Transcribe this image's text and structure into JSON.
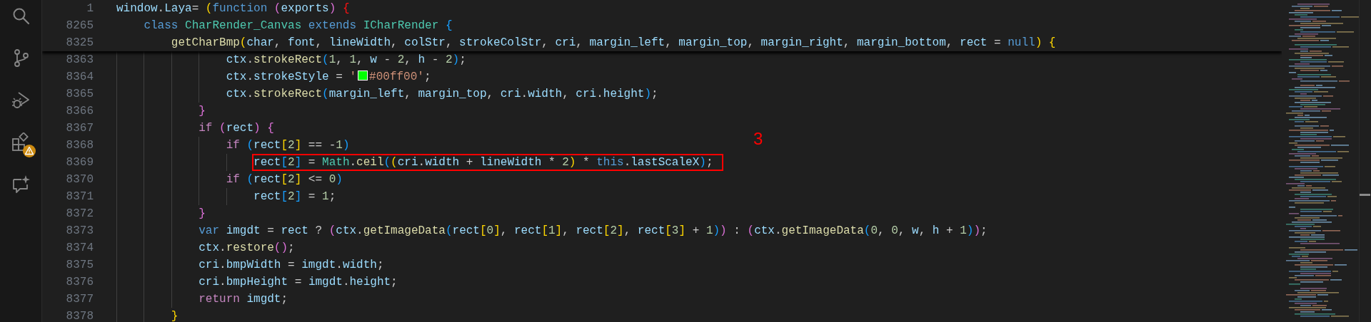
{
  "activity_bar": {
    "items": [
      {
        "kind": "search",
        "warning": false
      },
      {
        "kind": "source-control",
        "warning": false
      },
      {
        "kind": "run-debug",
        "warning": false
      },
      {
        "kind": "extensions",
        "warning": true
      },
      {
        "kind": "chat",
        "warning": false
      }
    ]
  },
  "editor": {
    "sticky_lines": [
      {
        "number": "1",
        "tokens": [
          {
            "kind": "var",
            "text": "window"
          },
          {
            "kind": "plain",
            "text": "."
          },
          {
            "kind": "var",
            "text": "Laya"
          },
          {
            "kind": "plain",
            "text": "= "
          },
          {
            "kind": "b1",
            "text": "("
          },
          {
            "kind": "kw",
            "text": "function"
          },
          {
            "kind": "b2",
            "text": " ("
          },
          {
            "kind": "var",
            "text": "exports"
          },
          {
            "kind": "b2",
            "text": ")"
          },
          {
            "kind": "bad",
            "text": " {"
          }
        ]
      },
      {
        "number": "8265",
        "tokens": [
          {
            "kind": "kw",
            "text": "    class"
          },
          {
            "kind": "cls",
            "text": " CharRender_Canvas"
          },
          {
            "kind": "kw",
            "text": " extends"
          },
          {
            "kind": "cls",
            "text": " ICharRender"
          },
          {
            "kind": "b3",
            "text": " {"
          }
        ]
      },
      {
        "number": "8325",
        "tokens": [
          {
            "kind": "fn",
            "text": "        getCharBmp"
          },
          {
            "kind": "b1",
            "text": "("
          },
          {
            "kind": "var",
            "text": "char"
          },
          {
            "kind": "plain",
            "text": ", "
          },
          {
            "kind": "var",
            "text": "font"
          },
          {
            "kind": "plain",
            "text": ", "
          },
          {
            "kind": "var",
            "text": "lineWidth"
          },
          {
            "kind": "plain",
            "text": ", "
          },
          {
            "kind": "var",
            "text": "colStr"
          },
          {
            "kind": "plain",
            "text": ", "
          },
          {
            "kind": "var",
            "text": "strokeColStr"
          },
          {
            "kind": "plain",
            "text": ", "
          },
          {
            "kind": "var",
            "text": "cri"
          },
          {
            "kind": "plain",
            "text": ", "
          },
          {
            "kind": "var",
            "text": "margin_left"
          },
          {
            "kind": "plain",
            "text": ", "
          },
          {
            "kind": "var",
            "text": "margin_top"
          },
          {
            "kind": "plain",
            "text": ", "
          },
          {
            "kind": "var",
            "text": "margin_right"
          },
          {
            "kind": "plain",
            "text": ", "
          },
          {
            "kind": "var",
            "text": "margin_bottom"
          },
          {
            "kind": "plain",
            "text": ", "
          },
          {
            "kind": "var",
            "text": "rect"
          },
          {
            "kind": "plain",
            "text": " = "
          },
          {
            "kind": "kw",
            "text": "null"
          },
          {
            "kind": "b1",
            "text": ")"
          },
          {
            "kind": "b1",
            "text": " {"
          }
        ]
      }
    ],
    "lines": [
      {
        "number": "8363",
        "boxed": false,
        "tokens": [
          {
            "kind": "var",
            "text": "                ctx"
          },
          {
            "kind": "plain",
            "text": "."
          },
          {
            "kind": "fn",
            "text": "strokeRect"
          },
          {
            "kind": "b3",
            "text": "("
          },
          {
            "kind": "num",
            "text": "1"
          },
          {
            "kind": "plain",
            "text": ", "
          },
          {
            "kind": "num",
            "text": "1"
          },
          {
            "kind": "plain",
            "text": ", "
          },
          {
            "kind": "var",
            "text": "w"
          },
          {
            "kind": "plain",
            "text": " - "
          },
          {
            "kind": "num",
            "text": "2"
          },
          {
            "kind": "plain",
            "text": ", "
          },
          {
            "kind": "var",
            "text": "h"
          },
          {
            "kind": "plain",
            "text": " - "
          },
          {
            "kind": "num",
            "text": "2"
          },
          {
            "kind": "b3",
            "text": ")"
          },
          {
            "kind": "plain",
            "text": ";"
          }
        ]
      },
      {
        "number": "8364",
        "boxed": false,
        "tokens": [
          {
            "kind": "var",
            "text": "                ctx"
          },
          {
            "kind": "plain",
            "text": "."
          },
          {
            "kind": "var",
            "text": "strokeStyle"
          },
          {
            "kind": "plain",
            "text": " = "
          },
          {
            "kind": "str",
            "text": "'"
          },
          {
            "kind": "swatch",
            "color": "#00ff00"
          },
          {
            "kind": "str",
            "text": "#00ff00'"
          },
          {
            "kind": "plain",
            "text": ";"
          }
        ]
      },
      {
        "number": "8365",
        "boxed": false,
        "tokens": [
          {
            "kind": "var",
            "text": "                ctx"
          },
          {
            "kind": "plain",
            "text": "."
          },
          {
            "kind": "fn",
            "text": "strokeRect"
          },
          {
            "kind": "b3",
            "text": "("
          },
          {
            "kind": "var",
            "text": "margin_left"
          },
          {
            "kind": "plain",
            "text": ", "
          },
          {
            "kind": "var",
            "text": "margin_top"
          },
          {
            "kind": "plain",
            "text": ", "
          },
          {
            "kind": "var",
            "text": "cri"
          },
          {
            "kind": "plain",
            "text": "."
          },
          {
            "kind": "var",
            "text": "width"
          },
          {
            "kind": "plain",
            "text": ", "
          },
          {
            "kind": "var",
            "text": "cri"
          },
          {
            "kind": "plain",
            "text": "."
          },
          {
            "kind": "var",
            "text": "height"
          },
          {
            "kind": "b3",
            "text": ")"
          },
          {
            "kind": "plain",
            "text": ";"
          }
        ]
      },
      {
        "number": "8366",
        "boxed": false,
        "tokens": [
          {
            "kind": "b2",
            "text": "            }"
          }
        ]
      },
      {
        "number": "8367",
        "boxed": false,
        "tokens": [
          {
            "kind": "ctl",
            "text": "            if"
          },
          {
            "kind": "b2",
            "text": " ("
          },
          {
            "kind": "var",
            "text": "rect"
          },
          {
            "kind": "b2",
            "text": ")"
          },
          {
            "kind": "b2",
            "text": " {"
          }
        ]
      },
      {
        "number": "8368",
        "boxed": false,
        "tokens": [
          {
            "kind": "ctl",
            "text": "                if"
          },
          {
            "kind": "b3",
            "text": " ("
          },
          {
            "kind": "var",
            "text": "rect"
          },
          {
            "kind": "b1",
            "text": "["
          },
          {
            "kind": "num",
            "text": "2"
          },
          {
            "kind": "b1",
            "text": "]"
          },
          {
            "kind": "plain",
            "text": " == -"
          },
          {
            "kind": "num",
            "text": "1"
          },
          {
            "kind": "b3",
            "text": ")"
          }
        ]
      },
      {
        "number": "8369",
        "boxed": true,
        "tokens": [
          {
            "kind": "var",
            "text": "                    rect"
          },
          {
            "kind": "b3",
            "text": "["
          },
          {
            "kind": "num",
            "text": "2"
          },
          {
            "kind": "b3",
            "text": "]"
          },
          {
            "kind": "plain",
            "text": " = "
          },
          {
            "kind": "cls",
            "text": "Math"
          },
          {
            "kind": "plain",
            "text": "."
          },
          {
            "kind": "fn",
            "text": "ceil"
          },
          {
            "kind": "b3",
            "text": "("
          },
          {
            "kind": "b1",
            "text": "("
          },
          {
            "kind": "var",
            "text": "cri"
          },
          {
            "kind": "plain",
            "text": "."
          },
          {
            "kind": "var",
            "text": "width"
          },
          {
            "kind": "plain",
            "text": " + "
          },
          {
            "kind": "var",
            "text": "lineWidth"
          },
          {
            "kind": "plain",
            "text": " * "
          },
          {
            "kind": "num",
            "text": "2"
          },
          {
            "kind": "b1",
            "text": ")"
          },
          {
            "kind": "plain",
            "text": " * "
          },
          {
            "kind": "kw",
            "text": "this"
          },
          {
            "kind": "plain",
            "text": "."
          },
          {
            "kind": "var",
            "text": "lastScaleX"
          },
          {
            "kind": "b3",
            "text": ")"
          },
          {
            "kind": "plain",
            "text": ";"
          }
        ]
      },
      {
        "number": "8370",
        "boxed": false,
        "tokens": [
          {
            "kind": "ctl",
            "text": "                if"
          },
          {
            "kind": "b3",
            "text": " ("
          },
          {
            "kind": "var",
            "text": "rect"
          },
          {
            "kind": "b1",
            "text": "["
          },
          {
            "kind": "num",
            "text": "2"
          },
          {
            "kind": "b1",
            "text": "]"
          },
          {
            "kind": "plain",
            "text": " <= "
          },
          {
            "kind": "num",
            "text": "0"
          },
          {
            "kind": "b3",
            "text": ")"
          }
        ]
      },
      {
        "number": "8371",
        "boxed": false,
        "tokens": [
          {
            "kind": "var",
            "text": "                    rect"
          },
          {
            "kind": "b3",
            "text": "["
          },
          {
            "kind": "num",
            "text": "2"
          },
          {
            "kind": "b3",
            "text": "]"
          },
          {
            "kind": "plain",
            "text": " = "
          },
          {
            "kind": "num",
            "text": "1"
          },
          {
            "kind": "plain",
            "text": ";"
          }
        ]
      },
      {
        "number": "8372",
        "boxed": false,
        "tokens": [
          {
            "kind": "b2",
            "text": "            }"
          }
        ]
      },
      {
        "number": "8373",
        "boxed": false,
        "tokens": [
          {
            "kind": "kw",
            "text": "            var"
          },
          {
            "kind": "var",
            "text": " imgdt"
          },
          {
            "kind": "plain",
            "text": " = "
          },
          {
            "kind": "var",
            "text": "rect"
          },
          {
            "kind": "plain",
            "text": " ? "
          },
          {
            "kind": "b2",
            "text": "("
          },
          {
            "kind": "var",
            "text": "ctx"
          },
          {
            "kind": "plain",
            "text": "."
          },
          {
            "kind": "fn",
            "text": "getImageData"
          },
          {
            "kind": "b3",
            "text": "("
          },
          {
            "kind": "var",
            "text": "rect"
          },
          {
            "kind": "b1",
            "text": "["
          },
          {
            "kind": "num",
            "text": "0"
          },
          {
            "kind": "b1",
            "text": "]"
          },
          {
            "kind": "plain",
            "text": ", "
          },
          {
            "kind": "var",
            "text": "rect"
          },
          {
            "kind": "b1",
            "text": "["
          },
          {
            "kind": "num",
            "text": "1"
          },
          {
            "kind": "b1",
            "text": "]"
          },
          {
            "kind": "plain",
            "text": ", "
          },
          {
            "kind": "var",
            "text": "rect"
          },
          {
            "kind": "b1",
            "text": "["
          },
          {
            "kind": "num",
            "text": "2"
          },
          {
            "kind": "b1",
            "text": "]"
          },
          {
            "kind": "plain",
            "text": ", "
          },
          {
            "kind": "var",
            "text": "rect"
          },
          {
            "kind": "b1",
            "text": "["
          },
          {
            "kind": "num",
            "text": "3"
          },
          {
            "kind": "b1",
            "text": "]"
          },
          {
            "kind": "plain",
            "text": " + "
          },
          {
            "kind": "num",
            "text": "1"
          },
          {
            "kind": "b3",
            "text": ")"
          },
          {
            "kind": "b2",
            "text": ")"
          },
          {
            "kind": "plain",
            "text": " : "
          },
          {
            "kind": "b2",
            "text": "("
          },
          {
            "kind": "var",
            "text": "ctx"
          },
          {
            "kind": "plain",
            "text": "."
          },
          {
            "kind": "fn",
            "text": "getImageData"
          },
          {
            "kind": "b3",
            "text": "("
          },
          {
            "kind": "num",
            "text": "0"
          },
          {
            "kind": "plain",
            "text": ", "
          },
          {
            "kind": "num",
            "text": "0"
          },
          {
            "kind": "plain",
            "text": ", "
          },
          {
            "kind": "var",
            "text": "w"
          },
          {
            "kind": "plain",
            "text": ", "
          },
          {
            "kind": "var",
            "text": "h"
          },
          {
            "kind": "plain",
            "text": " + "
          },
          {
            "kind": "num",
            "text": "1"
          },
          {
            "kind": "b3",
            "text": ")"
          },
          {
            "kind": "b2",
            "text": ")"
          },
          {
            "kind": "plain",
            "text": ";"
          }
        ]
      },
      {
        "number": "8374",
        "boxed": false,
        "tokens": [
          {
            "kind": "var",
            "text": "            ctx"
          },
          {
            "kind": "plain",
            "text": "."
          },
          {
            "kind": "fn",
            "text": "restore"
          },
          {
            "kind": "b2",
            "text": "()"
          },
          {
            "kind": "plain",
            "text": ";"
          }
        ]
      },
      {
        "number": "8375",
        "boxed": false,
        "tokens": [
          {
            "kind": "var",
            "text": "            cri"
          },
          {
            "kind": "plain",
            "text": "."
          },
          {
            "kind": "var",
            "text": "bmpWidth"
          },
          {
            "kind": "plain",
            "text": " = "
          },
          {
            "kind": "var",
            "text": "imgdt"
          },
          {
            "kind": "plain",
            "text": "."
          },
          {
            "kind": "var",
            "text": "width"
          },
          {
            "kind": "plain",
            "text": ";"
          }
        ]
      },
      {
        "number": "8376",
        "boxed": false,
        "tokens": [
          {
            "kind": "var",
            "text": "            cri"
          },
          {
            "kind": "plain",
            "text": "."
          },
          {
            "kind": "var",
            "text": "bmpHeight"
          },
          {
            "kind": "plain",
            "text": " = "
          },
          {
            "kind": "var",
            "text": "imgdt"
          },
          {
            "kind": "plain",
            "text": "."
          },
          {
            "kind": "var",
            "text": "height"
          },
          {
            "kind": "plain",
            "text": ";"
          }
        ]
      },
      {
        "number": "8377",
        "boxed": false,
        "tokens": [
          {
            "kind": "ctl",
            "text": "            return"
          },
          {
            "kind": "var",
            "text": " imgdt"
          },
          {
            "kind": "plain",
            "text": ";"
          }
        ]
      },
      {
        "number": "8378",
        "boxed": false,
        "tokens": [
          {
            "kind": "b1",
            "text": "        }"
          }
        ]
      }
    ],
    "annotation": {
      "label": "3"
    }
  }
}
